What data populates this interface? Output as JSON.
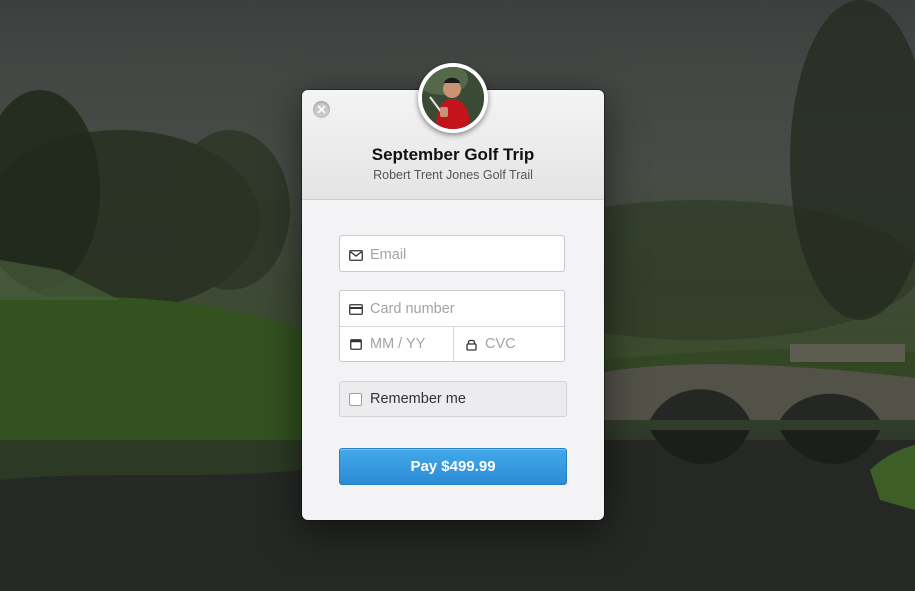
{
  "modal": {
    "title": "September Golf Trip",
    "subtitle": "Robert Trent Jones Golf Trail"
  },
  "form": {
    "email_placeholder": "Email",
    "card_number_placeholder": "Card number",
    "expiry_placeholder": "MM / YY",
    "cvc_placeholder": "CVC",
    "remember_label": "Remember me",
    "remember_checked": false,
    "pay_label": "Pay $499.99"
  },
  "icons": {
    "close": "close-icon",
    "email": "envelope-icon",
    "card": "credit-card-icon",
    "expiry": "calendar-icon",
    "cvc": "lock-icon"
  },
  "colors": {
    "pay_button": "#2f95dc",
    "modal_bg": "#f3f3f5",
    "placeholder": "#a3a3a8"
  }
}
